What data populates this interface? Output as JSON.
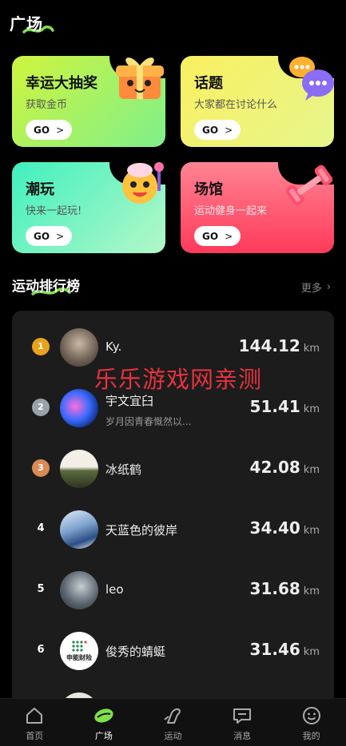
{
  "header": {
    "title": "广场"
  },
  "cards": [
    {
      "title": "幸运大抽奖",
      "subtitle": "获取金币",
      "go": "GO",
      "bg_from": "#c8f24a",
      "bg_to": "#7ef08a"
    },
    {
      "title": "话题",
      "subtitle": "大家都在讨论什么",
      "go": "GO",
      "bg_from": "#f7f26a",
      "bg_to": "#e9f58a"
    },
    {
      "title": "潮玩",
      "subtitle": "快来一起玩!",
      "go": "GO",
      "bg_from": "#4ff1c0",
      "bg_to": "#a6f6c7"
    },
    {
      "title": "场馆",
      "subtitle": "运动健身一起来",
      "go": "GO",
      "bg_from": "#ff7f8e",
      "bg_to": "#ff3f5c"
    }
  ],
  "ranking": {
    "title": "运动排行榜",
    "more": "更多",
    "unit": "km",
    "rows": [
      {
        "rank": "1",
        "name": "Ky.",
        "signature": "",
        "distance": "144.12"
      },
      {
        "rank": "2",
        "name": "宇文宜臼",
        "signature": "岁月因青春慨然以...",
        "distance": "51.41"
      },
      {
        "rank": "3",
        "name": "冰纸鹤",
        "signature": "",
        "distance": "42.08"
      },
      {
        "rank": "4",
        "name": "天蓝色的彼岸",
        "signature": "",
        "distance": "34.40"
      },
      {
        "rank": "5",
        "name": "leo",
        "signature": "",
        "distance": "31.68"
      },
      {
        "rank": "6",
        "name": "俊秀的蜻蜓",
        "signature": "",
        "distance": "31.46"
      }
    ]
  },
  "avatar6_text": "申能财险",
  "watermark": "乐乐游戏网亲测",
  "tabs": [
    {
      "label": "首页",
      "icon": "home-icon"
    },
    {
      "label": "广场",
      "icon": "plaza-leaf-icon",
      "active": true
    },
    {
      "label": "运动",
      "icon": "sport-shoe-icon"
    },
    {
      "label": "消息",
      "icon": "message-icon"
    },
    {
      "label": "我的",
      "icon": "profile-smile-icon"
    }
  ],
  "colors": {
    "accent": "#7ee04a",
    "medal_gold": "#e8a31c",
    "medal_silver": "#9aa3ab",
    "medal_bronze": "#d98a55",
    "watermark": "#e8323f"
  }
}
